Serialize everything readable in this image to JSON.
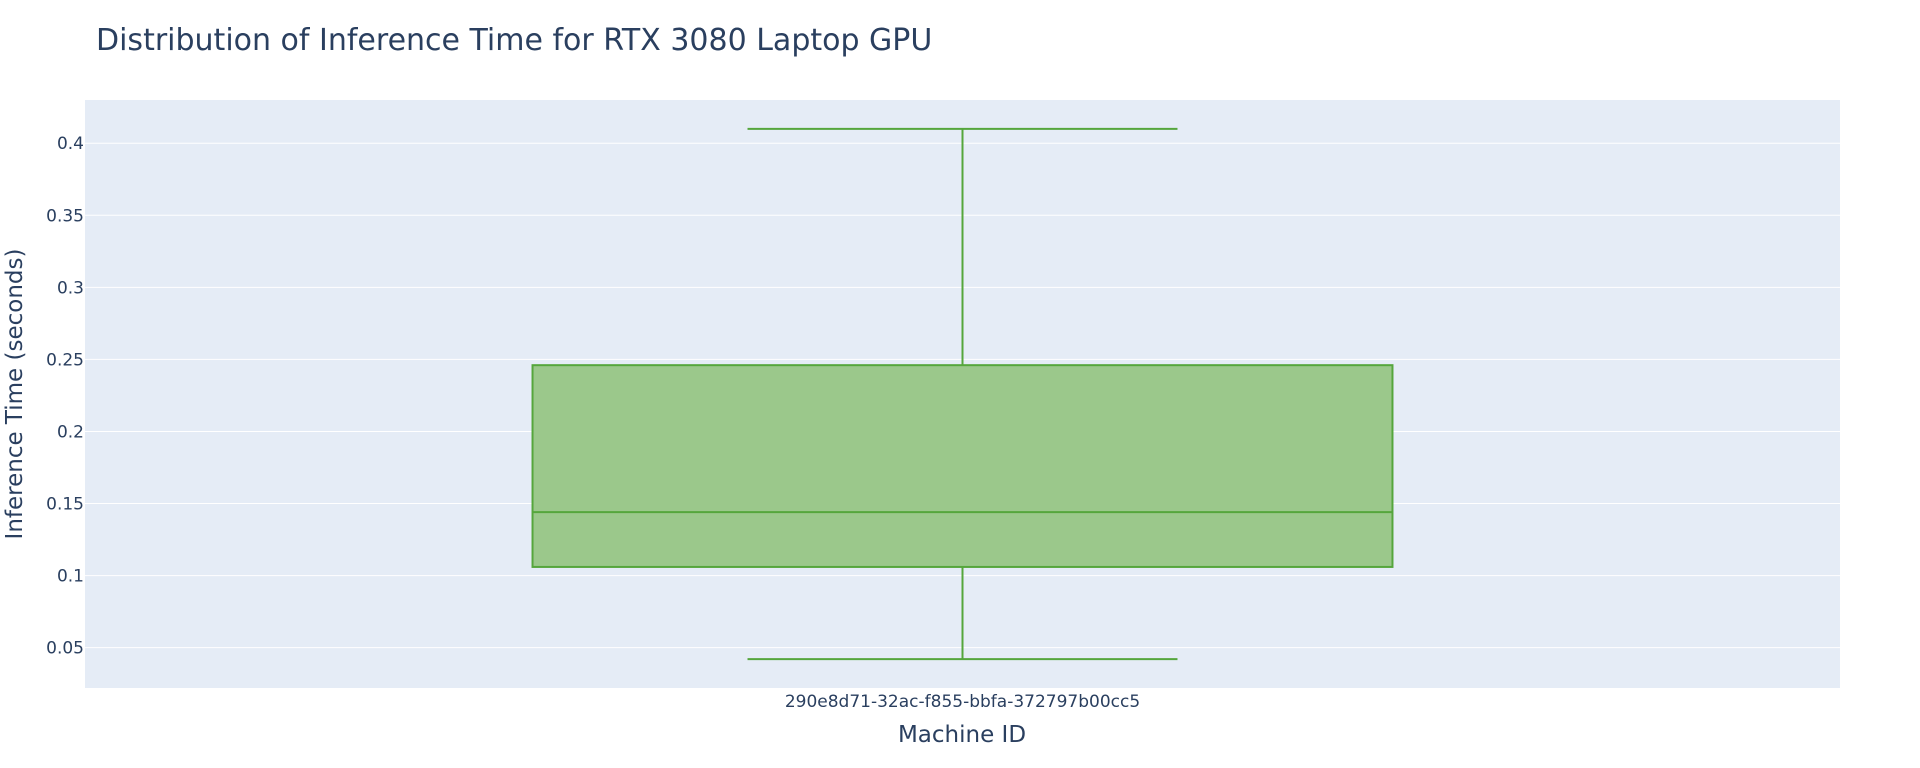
{
  "chart_data": {
    "type": "box",
    "title": "Distribution of Inference Time for RTX 3080 Laptop GPU",
    "xlabel": "Machine ID",
    "ylabel": "Inference Time (seconds)",
    "categories": [
      "290e8d71-32ac-f855-bbfa-372797b00cc5"
    ],
    "series": [
      {
        "category": "290e8d71-32ac-f855-bbfa-372797b00cc5",
        "min": 0.042,
        "q1": 0.106,
        "median": 0.144,
        "q3": 0.246,
        "max": 0.41
      }
    ],
    "ylim": [
      0.022,
      0.43
    ],
    "yticks": [
      0.05,
      0.1,
      0.15,
      0.2,
      0.25,
      0.3,
      0.35,
      0.4
    ],
    "ytick_labels": [
      "0.05",
      "0.1",
      "0.15",
      "0.2",
      "0.25",
      "0.3",
      "0.35",
      "0.4"
    ],
    "grid": true,
    "legend": "none",
    "colors": {
      "box_fill": "#9bc88b",
      "box_line": "#55a63c",
      "plot_bg": "#e5ecf6",
      "grid": "#ffffff",
      "text": "#2a3f5f"
    }
  }
}
